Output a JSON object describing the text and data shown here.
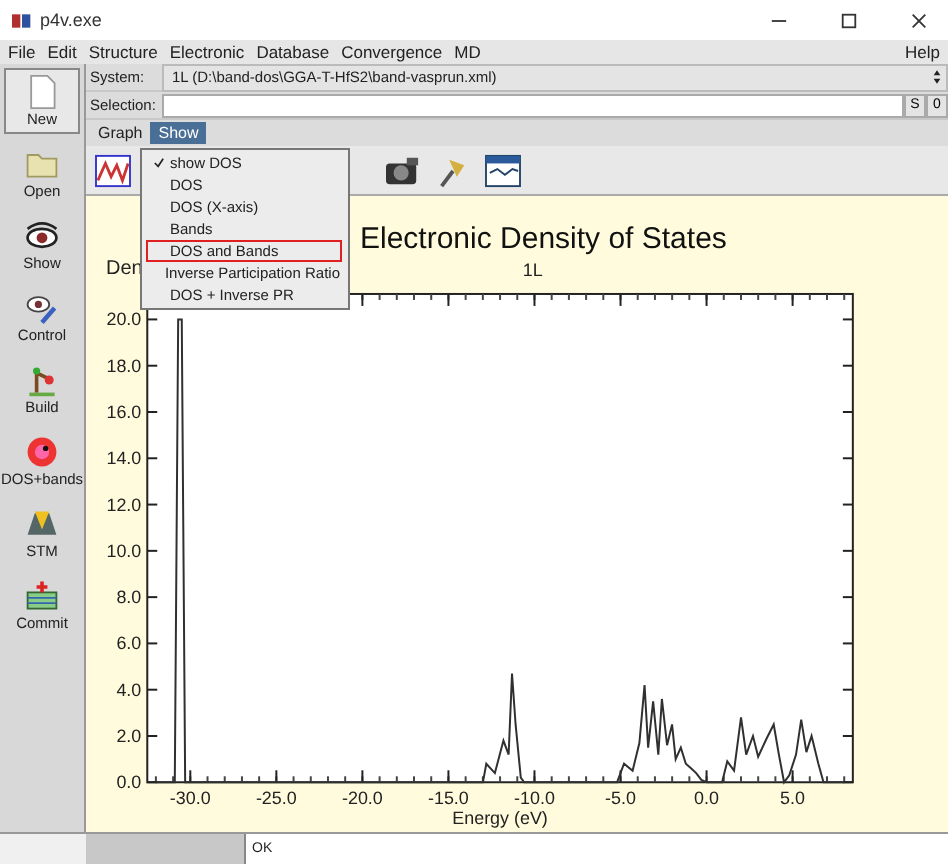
{
  "window": {
    "title": "p4v.exe"
  },
  "menu_bar": {
    "items": [
      "File",
      "Edit",
      "Structure",
      "Electronic",
      "Database",
      "Convergence",
      "MD"
    ],
    "help": "Help"
  },
  "sidebar": {
    "items": [
      {
        "label": "New",
        "selected": true
      },
      {
        "label": "Open",
        "selected": false
      },
      {
        "label": "Show",
        "selected": false
      },
      {
        "label": "Control",
        "selected": false
      },
      {
        "label": "Build",
        "selected": false
      },
      {
        "label": "DOS+bands",
        "selected": false
      },
      {
        "label": "STM",
        "selected": false
      },
      {
        "label": "Commit",
        "selected": false
      }
    ]
  },
  "system": {
    "label": "System:",
    "value": "1L (D:\\band-dos\\GGA-T-HfS2\\band-vasprun.xml)"
  },
  "selection": {
    "label": "Selection:",
    "buttons": [
      "S",
      "0"
    ]
  },
  "tabs": [
    {
      "label": "Graph",
      "selected": false
    },
    {
      "label": "Show",
      "selected": true
    }
  ],
  "show_menu": {
    "items": [
      {
        "label": "show DOS",
        "checked": true,
        "highlighted": false
      },
      {
        "label": "DOS",
        "checked": false,
        "highlighted": false
      },
      {
        "label": "DOS (X-axis)",
        "checked": false,
        "highlighted": false
      },
      {
        "label": "Bands",
        "checked": false,
        "highlighted": false
      },
      {
        "label": "DOS and Bands",
        "checked": false,
        "highlighted": true
      },
      {
        "label": "Inverse Participation Ratio",
        "checked": false,
        "highlighted": false
      },
      {
        "label": "DOS + Inverse PR",
        "checked": false,
        "highlighted": false
      }
    ]
  },
  "plot": {
    "title": "Electronic Density of States",
    "subtitle": "1L",
    "chart_data": {
      "type": "line",
      "xlabel": "Energy (eV)",
      "ylabel": "Den",
      "xlim": [
        -32.5,
        8.5
      ],
      "ylim": [
        0,
        21.1
      ],
      "xticks": [
        {
          "value": -30,
          "label": "-30.0"
        },
        {
          "value": -25,
          "label": "-25.0"
        },
        {
          "value": -20,
          "label": "-20.0"
        },
        {
          "value": -15,
          "label": "-15.0"
        },
        {
          "value": -10,
          "label": "-10.0"
        },
        {
          "value": -5,
          "label": "-5.0"
        },
        {
          "value": 0,
          "label": "0.0"
        },
        {
          "value": 5,
          "label": "5.0"
        }
      ],
      "yticks": [
        {
          "value": 0,
          "label": "0.0"
        },
        {
          "value": 2,
          "label": "2.0"
        },
        {
          "value": 4,
          "label": "4.0"
        },
        {
          "value": 6,
          "label": "6.0"
        },
        {
          "value": 8,
          "label": "8.0"
        },
        {
          "value": 10,
          "label": "10.0"
        },
        {
          "value": 12,
          "label": "12.0"
        },
        {
          "value": 14,
          "label": "14.0"
        },
        {
          "value": 16,
          "label": "16.0"
        },
        {
          "value": 18,
          "label": "18.0"
        },
        {
          "value": 20,
          "label": "20.0"
        }
      ],
      "x": [
        -32,
        -30.9,
        -30.7,
        -30.5,
        -30.3,
        -30.1,
        -13,
        -12.8,
        -12.3,
        -11.8,
        -11.5,
        -11.3,
        -11.1,
        -10.8,
        -10.6,
        -5.2,
        -4.8,
        -4.3,
        -3.9,
        -3.6,
        -3.4,
        -3.1,
        -2.8,
        -2.6,
        -2.3,
        -2.0,
        -1.8,
        -1.5,
        -1.2,
        -0.9,
        -0.6,
        -0.3,
        0,
        0.9,
        1.2,
        1.6,
        2.0,
        2.3,
        2.7,
        3.0,
        3.5,
        3.9,
        4.2,
        4.5,
        4.8,
        5.2,
        5.5,
        5.8,
        6.1,
        6.5,
        6.8,
        8
      ],
      "series": [
        {
          "color": "#303030",
          "values": [
            0,
            0,
            20,
            20,
            0,
            0,
            0,
            0.8,
            0.4,
            1.8,
            1.2,
            4.7,
            2.5,
            0.2,
            0,
            0,
            0.8,
            0.5,
            1.7,
            4.2,
            1.5,
            3.5,
            1.2,
            3.6,
            1.6,
            2.5,
            1.0,
            1.5,
            0.8,
            0.6,
            0.4,
            0.1,
            0,
            0,
            0.9,
            0.5,
            2.8,
            1.2,
            2.0,
            1.1,
            1.9,
            2.5,
            1.2,
            0,
            0.3,
            1.2,
            2.7,
            1.3,
            2.0,
            0.8,
            0,
            0
          ]
        }
      ]
    }
  },
  "status_bar": {
    "message": "OK"
  }
}
